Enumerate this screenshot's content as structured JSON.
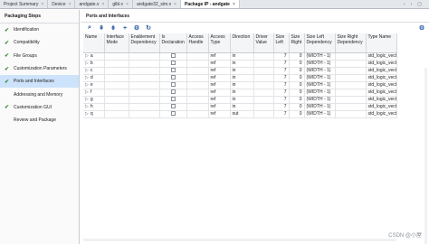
{
  "tabs": [
    {
      "label": "Project Summary",
      "active": false
    },
    {
      "label": "Device",
      "active": false
    },
    {
      "label": "andgate.v",
      "active": false
    },
    {
      "label": "glbl.v",
      "active": false
    },
    {
      "label": "andgate32_sim.v",
      "active": false
    },
    {
      "label": "Package IP - andgate",
      "active": true
    }
  ],
  "left_panel": {
    "title": "Packaging Steps",
    "steps": [
      {
        "label": "Identification",
        "done": true,
        "selected": false
      },
      {
        "label": "Compatibility",
        "done": true,
        "selected": false
      },
      {
        "label": "File Groups",
        "done": true,
        "selected": false
      },
      {
        "label": "Customization Parameters",
        "done": true,
        "selected": false
      },
      {
        "label": "Ports and Interfaces",
        "done": true,
        "selected": true
      },
      {
        "label": "Addressing and Memory",
        "done": false,
        "selected": false
      },
      {
        "label": "Customization GUI",
        "done": true,
        "selected": false
      },
      {
        "label": "Review and Package",
        "done": false,
        "selected": false
      }
    ]
  },
  "main": {
    "title": "Ports and Interfaces",
    "toolbar_icons": [
      "search-icon",
      "collapse-all-icon",
      "expand-all-icon",
      "add-icon",
      "auto-infer-icon",
      "refresh-icon"
    ],
    "columns": [
      "Name",
      "Interface Mode",
      "Enablement Dependency",
      "Is Declaration",
      "Access Handle",
      "Access Type",
      "Direction",
      "Driver Value",
      "Size Left",
      "Size Right",
      "Size Left Dependency",
      "Size Right Dependency",
      "Type Name"
    ],
    "rows": [
      {
        "name": "a",
        "access_type": "ref",
        "direction": "in",
        "size_left": "7",
        "size_right": "0",
        "size_left_dep": "(WIDTH - 1)",
        "type_name": "std_logic_vector"
      },
      {
        "name": "b",
        "access_type": "ref",
        "direction": "in",
        "size_left": "7",
        "size_right": "0",
        "size_left_dep": "(WIDTH - 1)",
        "type_name": "std_logic_vector"
      },
      {
        "name": "c",
        "access_type": "ref",
        "direction": "in",
        "size_left": "7",
        "size_right": "0",
        "size_left_dep": "(WIDTH - 1)",
        "type_name": "std_logic_vector"
      },
      {
        "name": "d",
        "access_type": "ref",
        "direction": "in",
        "size_left": "7",
        "size_right": "0",
        "size_left_dep": "(WIDTH - 1)",
        "type_name": "std_logic_vector"
      },
      {
        "name": "e",
        "access_type": "ref",
        "direction": "in",
        "size_left": "7",
        "size_right": "0",
        "size_left_dep": "(WIDTH - 1)",
        "type_name": "std_logic_vector"
      },
      {
        "name": "f",
        "access_type": "ref",
        "direction": "in",
        "size_left": "7",
        "size_right": "0",
        "size_left_dep": "(WIDTH - 1)",
        "type_name": "std_logic_vector"
      },
      {
        "name": "g",
        "access_type": "ref",
        "direction": "in",
        "size_left": "7",
        "size_right": "0",
        "size_left_dep": "(WIDTH - 1)",
        "type_name": "std_logic_vector"
      },
      {
        "name": "h",
        "access_type": "ref",
        "direction": "in",
        "size_left": "7",
        "size_right": "0",
        "size_left_dep": "(WIDTH - 1)",
        "type_name": "std_logic_vector"
      },
      {
        "name": "q",
        "access_type": "ref",
        "direction": "out",
        "size_left": "7",
        "size_right": "0",
        "size_left_dep": "(WIDTH - 1)",
        "type_name": "std_logic_vector"
      }
    ]
  },
  "watermark": "CSDN @小屋"
}
